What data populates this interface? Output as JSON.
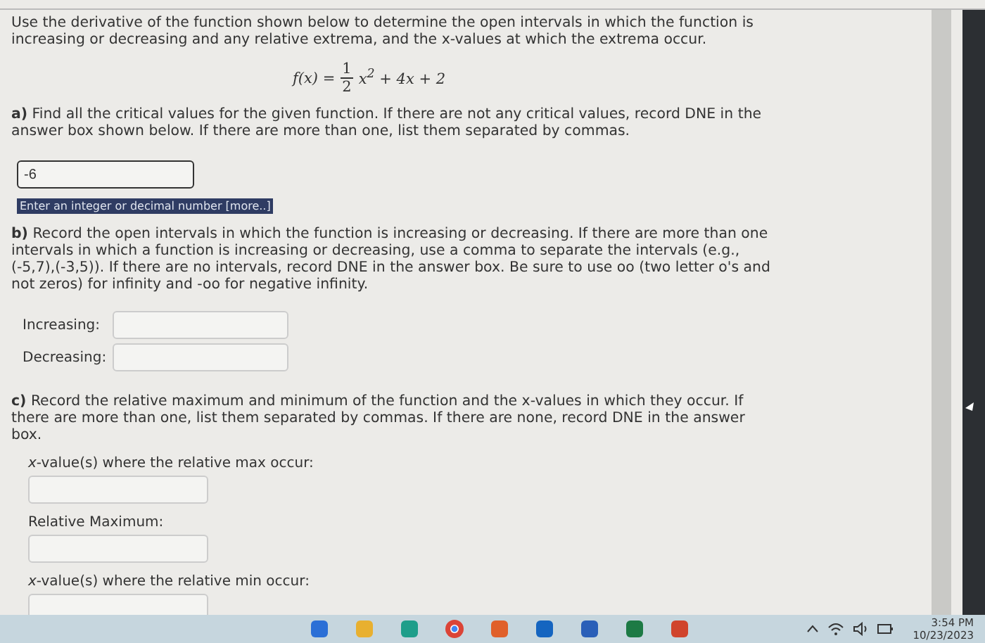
{
  "intro": "Use the derivative of the function shown below to determine the open intervals in which the function is increasing or decreasing and any relative extrema, and the x-values at which the extrema occur.",
  "formula": {
    "lhs": "f(x) =",
    "numerator": "1",
    "denominator": "2",
    "rest": "x$^{2}$ + 4x + 2"
  },
  "part_a": {
    "label": "a)",
    "text": "Find all the critical values for the given function. If there are not any critical values, record DNE in the answer box shown below. If there are more than one, list them separated by commas.",
    "answer": "-6",
    "hint": "Enter an integer or decimal number",
    "hint_link": "[more..]"
  },
  "part_b": {
    "label": "b)",
    "text": "Record the open intervals in which the function is increasing or decreasing. If there are more than one intervals in which a function is increasing or decreasing, use a comma to separate the intervals (e.g., (-5,7),(-3,5)). If there are no intervals, record DNE in the answer box. Be sure to use oo (two letter o's and not zeros) for infinity and -oo for negative infinity.",
    "fields": [
      {
        "label": "Increasing:"
      },
      {
        "label": "Decreasing:"
      }
    ]
  },
  "part_c": {
    "label": "c)",
    "text": "Record the relative maximum and minimum of the function and the x-values in which they occur. If there are more than one, list them separated by commas. If there are none, record DNE in the answer box.",
    "fields": [
      {
        "label": "*x*-value(s) where the relative max occur:"
      },
      {
        "label": "Relative Maximum:"
      },
      {
        "label": "*x*-value(s) where the relative min occur:"
      }
    ]
  },
  "taskbar": {
    "time": "3:54 PM",
    "date": "10/23/2023"
  }
}
